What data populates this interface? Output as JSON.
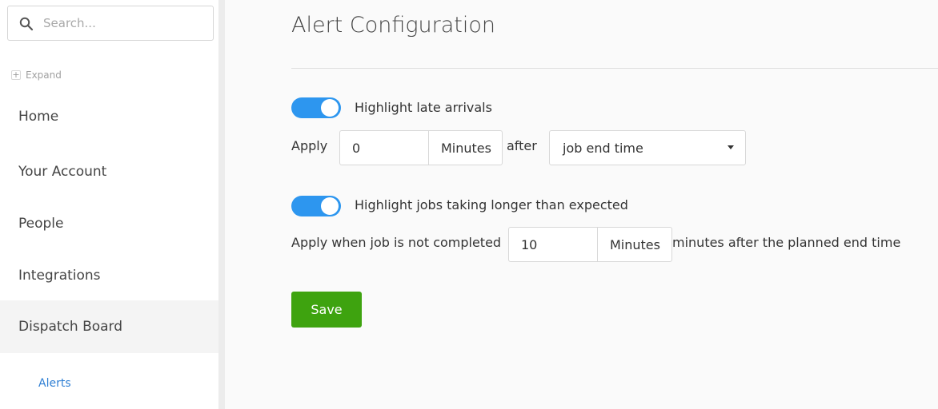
{
  "search": {
    "placeholder": "Search..."
  },
  "sidebar": {
    "expand_label": "Expand",
    "items": [
      {
        "label": "Home"
      },
      {
        "label": "Your Account"
      },
      {
        "label": "People"
      },
      {
        "label": "Integrations"
      },
      {
        "label": "Dispatch Board"
      }
    ],
    "sub_item": "Alerts"
  },
  "main": {
    "title": "Alert Configuration",
    "late_arrivals": {
      "enabled": true,
      "label": "Highlight late arrivals",
      "apply_text": "Apply",
      "value": "0",
      "unit": "Minutes",
      "after_text": "after",
      "reference_option": "job end time"
    },
    "longer_jobs": {
      "enabled": true,
      "label": "Highlight jobs taking longer than expected",
      "apply_text": "Apply when job is not completed",
      "value": "10",
      "unit": "Minutes",
      "suffix_text": "minutes after the planned end time"
    },
    "save_label": "Save"
  },
  "colors": {
    "toggle_on": "#2d96ef",
    "save_button": "#3ea30f",
    "active_link": "#2f7fd4"
  }
}
